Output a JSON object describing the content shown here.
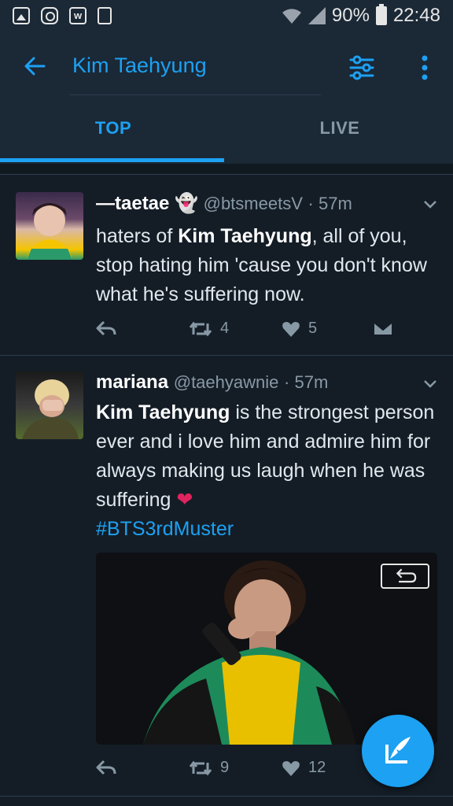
{
  "status_bar": {
    "battery": "90%",
    "time": "22:48",
    "left_icons": [
      "gallery-icon",
      "instagram-icon",
      "wattpad-icon",
      "clipboard-icon"
    ]
  },
  "app_bar": {
    "search_query": "Kim Taehyung",
    "tabs": [
      {
        "label": "TOP",
        "selected": true
      },
      {
        "label": "LIVE",
        "selected": false
      }
    ],
    "accent": "#1da1f2"
  },
  "tweets": [
    {
      "name": "—taetae 👻",
      "handle": "@btsmeetsV",
      "time": "· 57m",
      "text_parts": [
        "haters of ",
        "Kim Taehyung",
        ", all of you, stop hating him 'cause you don't know what he's suffering now."
      ],
      "retweets": "4",
      "likes": "5"
    },
    {
      "name": "mariana",
      "handle": "@taehyawnie",
      "time": "· 57m",
      "text_parts": [
        "Kim Taehyung",
        " is the strongest person ever and i love him and admire him for always making us laugh when he was suffering ",
        "❤"
      ],
      "hashtag": "#BTS3rdMuster",
      "retweets": "9",
      "likes": "12"
    }
  ]
}
